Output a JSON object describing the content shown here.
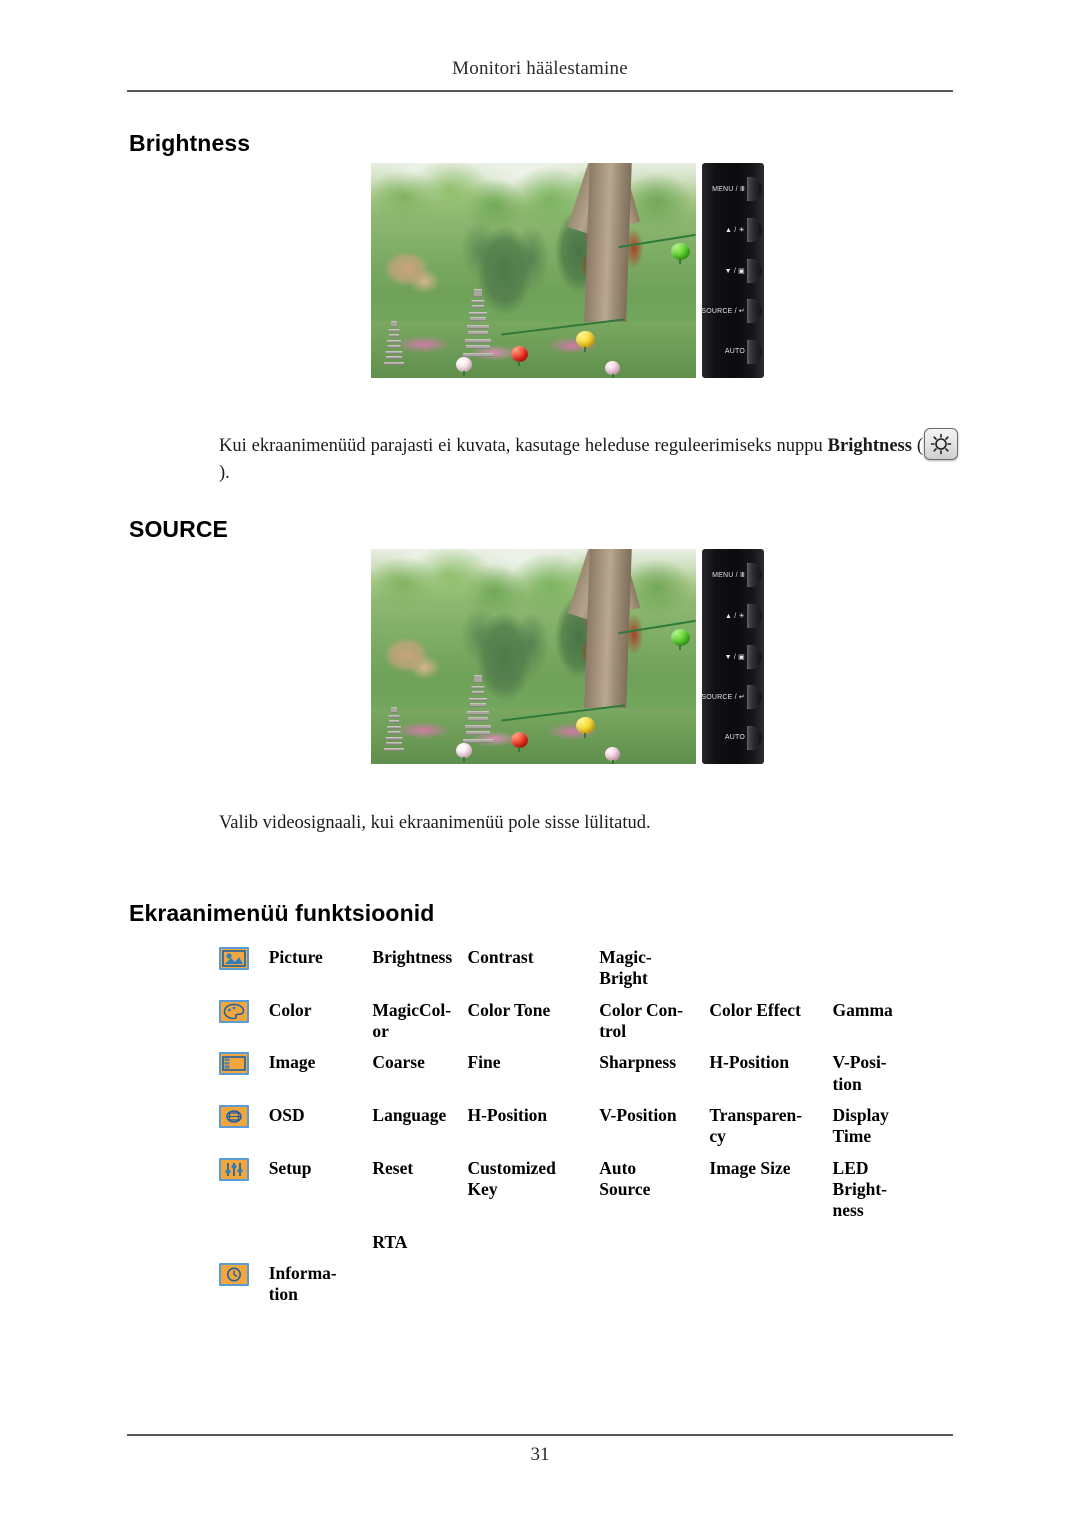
{
  "header": {
    "running_title": "Monitori häälestamine"
  },
  "footer": {
    "page_number": "31"
  },
  "sections": {
    "brightness": {
      "heading": "Brightness",
      "paragraph_before": "Kui ekraanimenüüd parajasti ei kuvata, kasutage heleduse reguleerimiseks nuppu ",
      "paragraph_bold": "Brightness",
      "paragraph_open_paren": " (",
      "paragraph_close_paren": ").",
      "key_icon": "brightness-sun-icon"
    },
    "source": {
      "heading": "SOURCE",
      "paragraph": "Valib videosignaali, kui ekraanimenüü pole sisse lülitatud."
    },
    "osd": {
      "heading": "Ekraanimenüü funktsioonid"
    }
  },
  "monitor_buttons": [
    {
      "label": "MENU / Ⅲ",
      "name": "menu-button"
    },
    {
      "label": "▲ / ☀",
      "name": "up-brightness-button"
    },
    {
      "label": "▼ / ▣",
      "name": "down-magicbright-button"
    },
    {
      "label": "SOURCE / ↵",
      "name": "source-enter-button"
    },
    {
      "label": "AUTO",
      "name": "auto-button"
    }
  ],
  "osd_table": {
    "rows": [
      {
        "icon": "picture-icon",
        "name": "Picture",
        "cells": [
          "Brightness",
          "Contrast",
          "Magic-\nBright",
          "",
          ""
        ]
      },
      {
        "icon": "color-palette-icon",
        "name": "Color",
        "cells": [
          "MagicCol-\nor",
          "Color Tone",
          "Color  Con-\ntrol",
          "Color Effect",
          "Gamma"
        ]
      },
      {
        "icon": "image-icon",
        "name": "Image",
        "cells": [
          "Coarse",
          "Fine",
          "Sharpness",
          "H-Position",
          "V-Posi-\ntion"
        ]
      },
      {
        "icon": "osd-icon",
        "name": "OSD",
        "cells": [
          "Language",
          "H-Position",
          "V-Position",
          "Transparen-\ncy",
          "Display\nTime"
        ]
      },
      {
        "icon": "setup-sliders-icon",
        "name": "Setup",
        "cells": [
          "Reset",
          "Customized\nKey",
          "Auto\nSource",
          "Image Size",
          "LED\nBright-\nness"
        ]
      },
      {
        "icon": "",
        "name": "",
        "cells": [
          "RTA",
          "",
          "",
          "",
          ""
        ]
      },
      {
        "icon": "information-clock-icon",
        "name": "Informa-\ntion",
        "cells": [
          "",
          "",
          "",
          "",
          ""
        ]
      }
    ]
  },
  "colors": {
    "icon_fill": "#f2a63b",
    "icon_border": "#5b9bd5",
    "rule": "#55585c",
    "text": "#000000"
  }
}
